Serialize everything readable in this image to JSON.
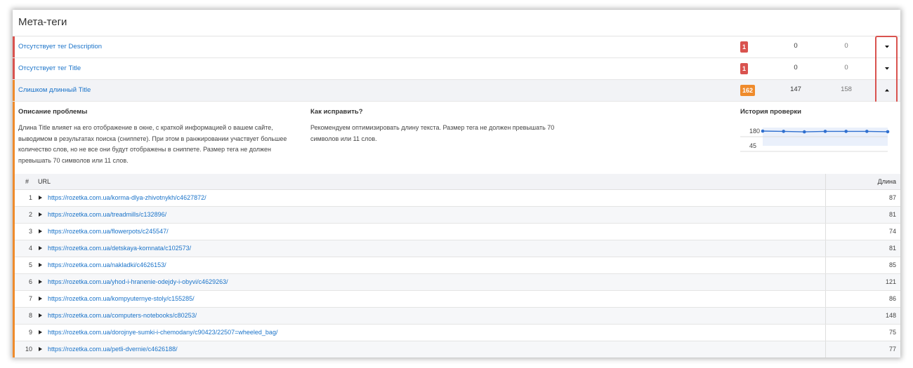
{
  "title": "Мета-теги",
  "issues": [
    {
      "label": "Отсутствует тег Description",
      "badge": "1",
      "count_a": "0",
      "count_b": "0"
    },
    {
      "label": "Отсутствует тег Title",
      "badge": "1",
      "count_a": "0",
      "count_b": "0"
    },
    {
      "label": "Слишком длинный Title",
      "badge": "162",
      "count_a": "147",
      "count_b": "158"
    }
  ],
  "details": {
    "problem_heading": "Описание проблемы",
    "problem_text": "Длина Title влияет на его отображение в окне, с краткой информацией о вашем сайте, выводимом в результатах поиска (сниппете). При этом в ранжировании участвует большее количество слов, но не все они будут отображены в сниппете. Размер тега не должен превышать 70 символов или 11 слов.",
    "fix_heading": "Как исправить?",
    "fix_text": "Рекомендуем оптимизировать длину текста. Размер тега не должен превышать 70 символов или 11 слов.",
    "history_heading": "История проверки",
    "history_axis": [
      "180",
      "45"
    ],
    "history_values": [
      180,
      178,
      175,
      178,
      178,
      178,
      176
    ]
  },
  "table": {
    "col_num": "#",
    "col_url": "URL",
    "col_len": "Длина",
    "rows": [
      {
        "n": "1",
        "url": "https://rozetka.com.ua/korma-dlya-zhivotnykh/c4627872/",
        "len": "87"
      },
      {
        "n": "2",
        "url": "https://rozetka.com.ua/treadmills/c132896/",
        "len": "81"
      },
      {
        "n": "3",
        "url": "https://rozetka.com.ua/flowerpots/c245547/",
        "len": "74"
      },
      {
        "n": "4",
        "url": "https://rozetka.com.ua/detskaya-komnata/c102573/",
        "len": "81"
      },
      {
        "n": "5",
        "url": "https://rozetka.com.ua/nakladki/c4626153/",
        "len": "85"
      },
      {
        "n": "6",
        "url": "https://rozetka.com.ua/yhod-i-hranenie-odejdy-i-obyvi/c4629263/",
        "len": "121"
      },
      {
        "n": "7",
        "url": "https://rozetka.com.ua/kompyuternye-stoly/c155285/",
        "len": "86"
      },
      {
        "n": "8",
        "url": "https://rozetka.com.ua/computers-notebooks/c80253/",
        "len": "148"
      },
      {
        "n": "9",
        "url": "https://rozetka.com.ua/dorojnye-sumki-i-chemodany/c90423/22507=wheeled_bag/",
        "len": "75"
      },
      {
        "n": "10",
        "url": "https://rozetka.com.ua/petli-dvernie/c4626188/",
        "len": "77"
      }
    ]
  },
  "colors": {
    "error": "#d9534f",
    "warning": "#ef8b2c",
    "link": "#1a73c9",
    "chart_line": "#2f6fcf"
  }
}
